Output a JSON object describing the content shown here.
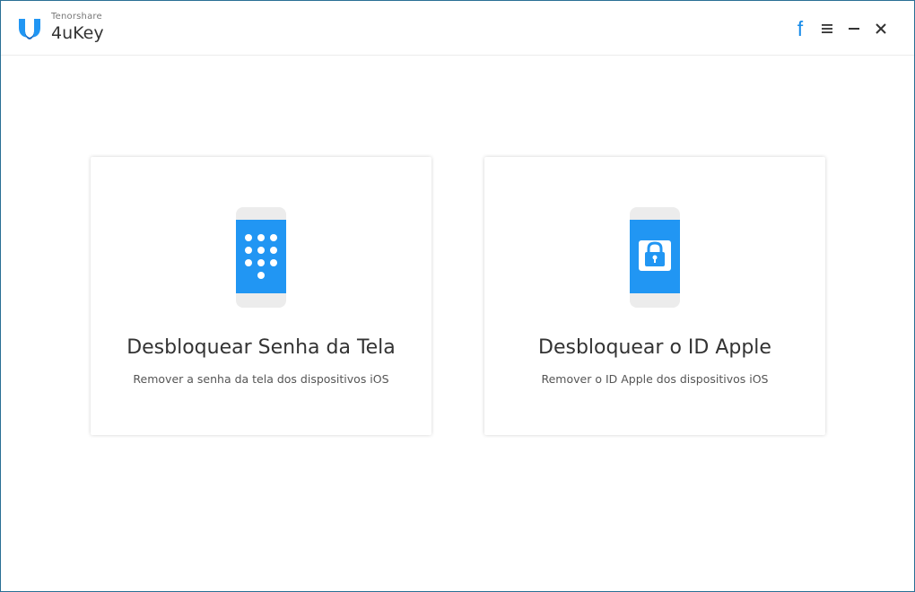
{
  "app": {
    "company": "Tenorshare",
    "product": "4uKey"
  },
  "titlebar": {
    "facebook_icon": "facebook-icon",
    "menu_icon": "menu-icon",
    "minimize_icon": "minimize-icon",
    "close_icon": "close-icon"
  },
  "options": [
    {
      "title": "Desbloquear Senha da Tela",
      "subtitle": "Remover a senha da tela dos dispositivos iOS",
      "icon": "phone-keypad-icon"
    },
    {
      "title": "Desbloquear o ID Apple",
      "subtitle": "Remover o ID Apple dos dispositivos iOS",
      "icon": "phone-lock-icon"
    }
  ],
  "colors": {
    "accent": "#2196f3",
    "facebook": "#1a8ce8",
    "phone_frame": "#ececec",
    "window_border": "#2a6f95"
  }
}
